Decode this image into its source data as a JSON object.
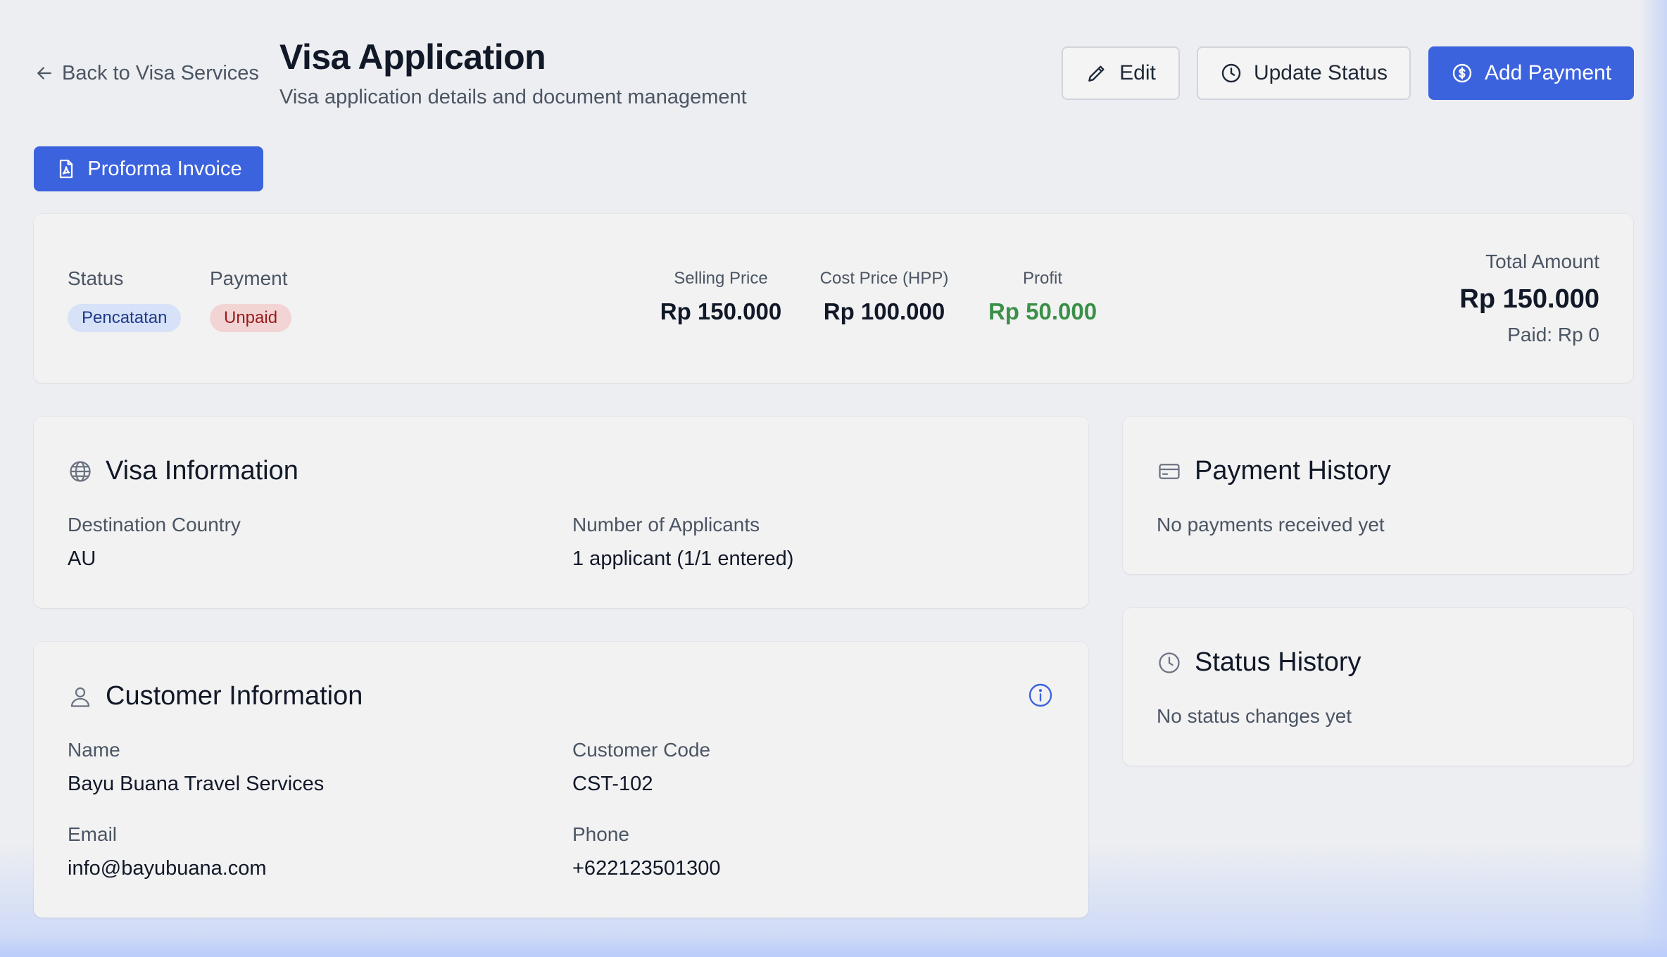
{
  "header": {
    "back_label": "Back to Visa Services",
    "title": "Visa Application",
    "subtitle": "Visa application details and document management",
    "edit_label": "Edit",
    "update_status_label": "Update Status",
    "add_payment_label": "Add Payment",
    "proforma_label": "Proforma Invoice"
  },
  "summary": {
    "status_label": "Status",
    "status_value": "Pencatatan",
    "payment_label": "Payment",
    "payment_value": "Unpaid",
    "selling_price_label": "Selling Price",
    "selling_price_value": "Rp 150.000",
    "cost_price_label": "Cost Price (HPP)",
    "cost_price_value": "Rp 100.000",
    "profit_label": "Profit",
    "profit_value": "Rp 50.000",
    "total_label": "Total Amount",
    "total_value": "Rp 150.000",
    "paid_value": "Paid: Rp 0"
  },
  "visa_info": {
    "title": "Visa Information",
    "destination_label": "Destination Country",
    "destination_value": "AU",
    "applicants_label": "Number of Applicants",
    "applicants_value": "1 applicant (1/1 entered)"
  },
  "customer_info": {
    "title": "Customer Information",
    "name_label": "Name",
    "name_value": "Bayu Buana Travel Services",
    "code_label": "Customer Code",
    "code_value": "CST-102",
    "email_label": "Email",
    "email_value": "info@bayubuana.com",
    "phone_label": "Phone",
    "phone_value": "+622123501300"
  },
  "payment_history": {
    "title": "Payment History",
    "empty_text": "No payments received yet"
  },
  "status_history": {
    "title": "Status History",
    "empty_text": "No status changes yet"
  },
  "colors": {
    "primary": "#3c63de",
    "profit_green": "#3b8f48",
    "status_badge_bg": "#d7e1f7",
    "unpaid_badge_bg": "#f3d4d4"
  },
  "icons": [
    "arrow-left-icon",
    "pencil-icon",
    "clock-icon",
    "dollar-circle-icon",
    "file-pdf-icon",
    "globe-icon",
    "user-icon",
    "info-icon",
    "credit-card-icon"
  ]
}
